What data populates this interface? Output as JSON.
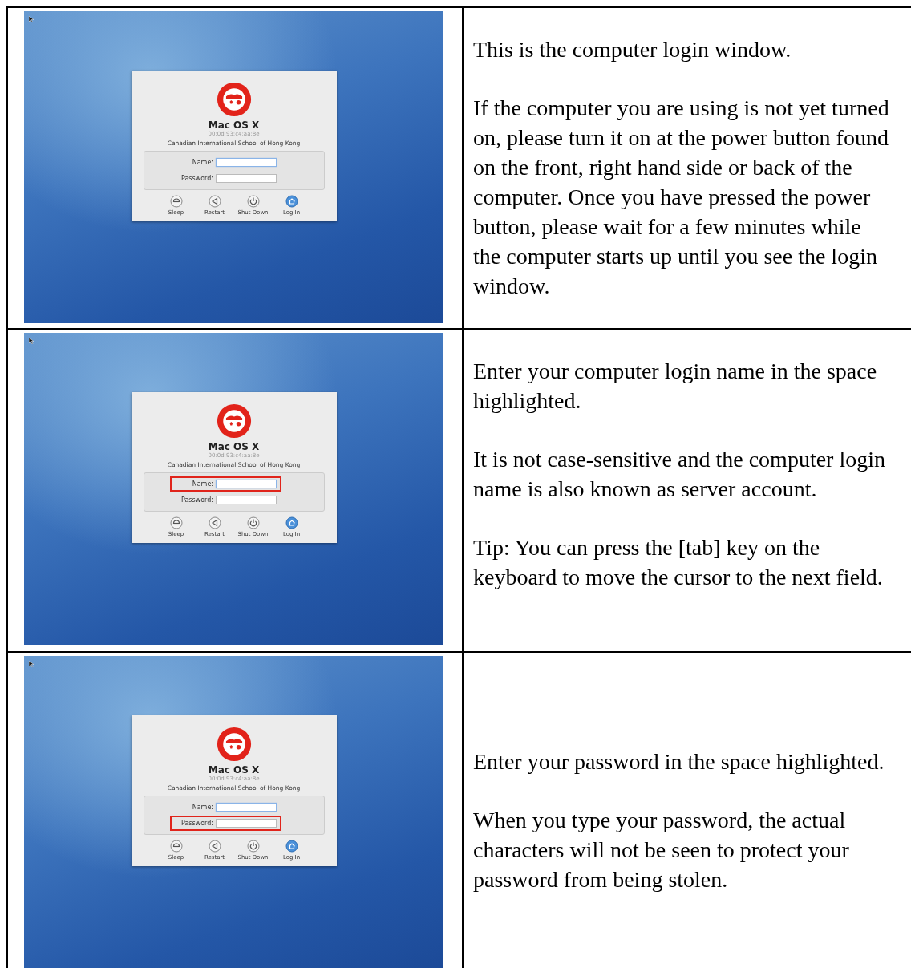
{
  "rows": [
    {
      "screen": {
        "window_title": "Mac OS X",
        "address": "00:0d:93:c4:aa:8e",
        "organization": "Canadian International School of Hong Kong",
        "fields": [
          {
            "label": "Name:",
            "focused": true,
            "highlighted": false
          },
          {
            "label": "Password:",
            "focused": false,
            "highlighted": false
          }
        ],
        "buttons": [
          {
            "kind": "sleep",
            "label": "Sleep"
          },
          {
            "kind": "restart",
            "label": "Restart"
          },
          {
            "kind": "shutdown",
            "label": "Shut Down"
          },
          {
            "kind": "login",
            "label": "Log In"
          }
        ]
      },
      "paragraphs": [
        "This is the computer login window.",
        "If the computer you are using is not yet turned on, please turn it on at the power button found on the front, right hand side or back of the computer. Once you have pressed the power button, please wait for a few minutes while the computer starts up until you see the login window."
      ]
    },
    {
      "screen": {
        "window_title": "Mac OS X",
        "address": "00:0d:93:c4:aa:8e",
        "organization": "Canadian International School of Hong Kong",
        "fields": [
          {
            "label": "Name:",
            "focused": true,
            "highlighted": true
          },
          {
            "label": "Password:",
            "focused": false,
            "highlighted": false
          }
        ],
        "buttons": [
          {
            "kind": "sleep",
            "label": "Sleep"
          },
          {
            "kind": "restart",
            "label": "Restart"
          },
          {
            "kind": "shutdown",
            "label": "Shut Down"
          },
          {
            "kind": "login",
            "label": "Log In"
          }
        ]
      },
      "paragraphs": [
        "Enter your computer login name in the space highlighted.",
        "It is not case-sensitive and the computer login name is also known as server account.",
        "Tip: You can press the [tab] key on the keyboard to move the cursor to the next field."
      ]
    },
    {
      "screen": {
        "window_title": "Mac OS X",
        "address": "00:0d:93:c4:aa:8e",
        "organization": "Canadian International School of Hong Kong",
        "fields": [
          {
            "label": "Name:",
            "focused": true,
            "highlighted": false
          },
          {
            "label": "Password:",
            "focused": false,
            "highlighted": true
          }
        ],
        "buttons": [
          {
            "kind": "sleep",
            "label": "Sleep"
          },
          {
            "kind": "restart",
            "label": "Restart"
          },
          {
            "kind": "shutdown",
            "label": "Shut Down"
          },
          {
            "kind": "login",
            "label": "Log In"
          }
        ]
      },
      "paragraphs": [
        "Enter your password in the space highlighted.",
        "When you type your password, the actual characters will not be seen to protect your password from being stolen."
      ]
    }
  ]
}
